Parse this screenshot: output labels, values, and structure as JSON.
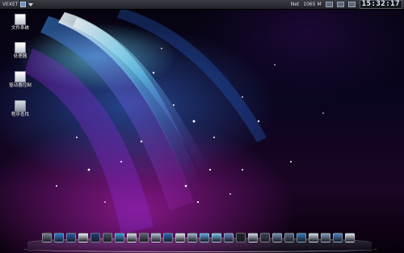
{
  "topbar": {
    "menu_label": "VEXET",
    "net_label": "Net",
    "memory": "1065 M",
    "clock": "15:32:17"
  },
  "desktop_icons": [
    {
      "label": "文件系统",
      "icon": "drive-icon"
    },
    {
      "label": "处理器",
      "icon": "chip-icon"
    },
    {
      "label": "驱动器控制",
      "icon": "drive-control-icon"
    },
    {
      "label": "程序查找",
      "icon": "program-search-icon"
    }
  ],
  "dock": {
    "items": [
      {
        "icon": "scissors-icon",
        "color": "#7a8090"
      },
      {
        "icon": "network-icon",
        "color": "#2f7fd0"
      },
      {
        "icon": "folder-icon",
        "color": "#2a5fa8"
      },
      {
        "icon": "pen-icon",
        "color": "#e9eef5"
      },
      {
        "icon": "eye-icon",
        "color": "#1c3f7d"
      },
      {
        "icon": "pyramid-icon",
        "color": "#4b5566"
      },
      {
        "icon": "mail-icon",
        "color": "#3f9fd9"
      },
      {
        "icon": "document-icon",
        "color": "#d9dde5"
      },
      {
        "icon": "compass-icon",
        "color": "#5d6574"
      },
      {
        "icon": "brush-icon",
        "color": "#b7c3d6"
      },
      {
        "icon": "globe-icon",
        "color": "#2c6eb5"
      },
      {
        "icon": "pdf-icon",
        "color": "#e0e3ea"
      },
      {
        "icon": "music-icon",
        "color": "#9fb4cc"
      },
      {
        "icon": "cloud-icon",
        "color": "#5fa9e6"
      },
      {
        "icon": "chat-icon",
        "color": "#7dc2f0"
      },
      {
        "icon": "refresh-icon",
        "color": "#6b88c9"
      },
      {
        "icon": "flash-icon",
        "color": "#202226"
      },
      {
        "icon": "photo-icon",
        "color": "#cfd7e4"
      },
      {
        "icon": "camera-icon",
        "color": "#3a4250"
      },
      {
        "icon": "gear-icon",
        "color": "#7a93b7"
      },
      {
        "icon": "terminal-icon",
        "color": "#5c6f86"
      },
      {
        "icon": "chart-icon",
        "color": "#2d7fc1"
      },
      {
        "icon": "search-icon",
        "color": "#cfd9e8"
      },
      {
        "icon": "monitor-icon",
        "color": "#8aa1c0"
      },
      {
        "icon": "download-icon",
        "color": "#4c86c8"
      },
      {
        "icon": "trash-icon",
        "color": "#dfe4ec"
      }
    ]
  }
}
